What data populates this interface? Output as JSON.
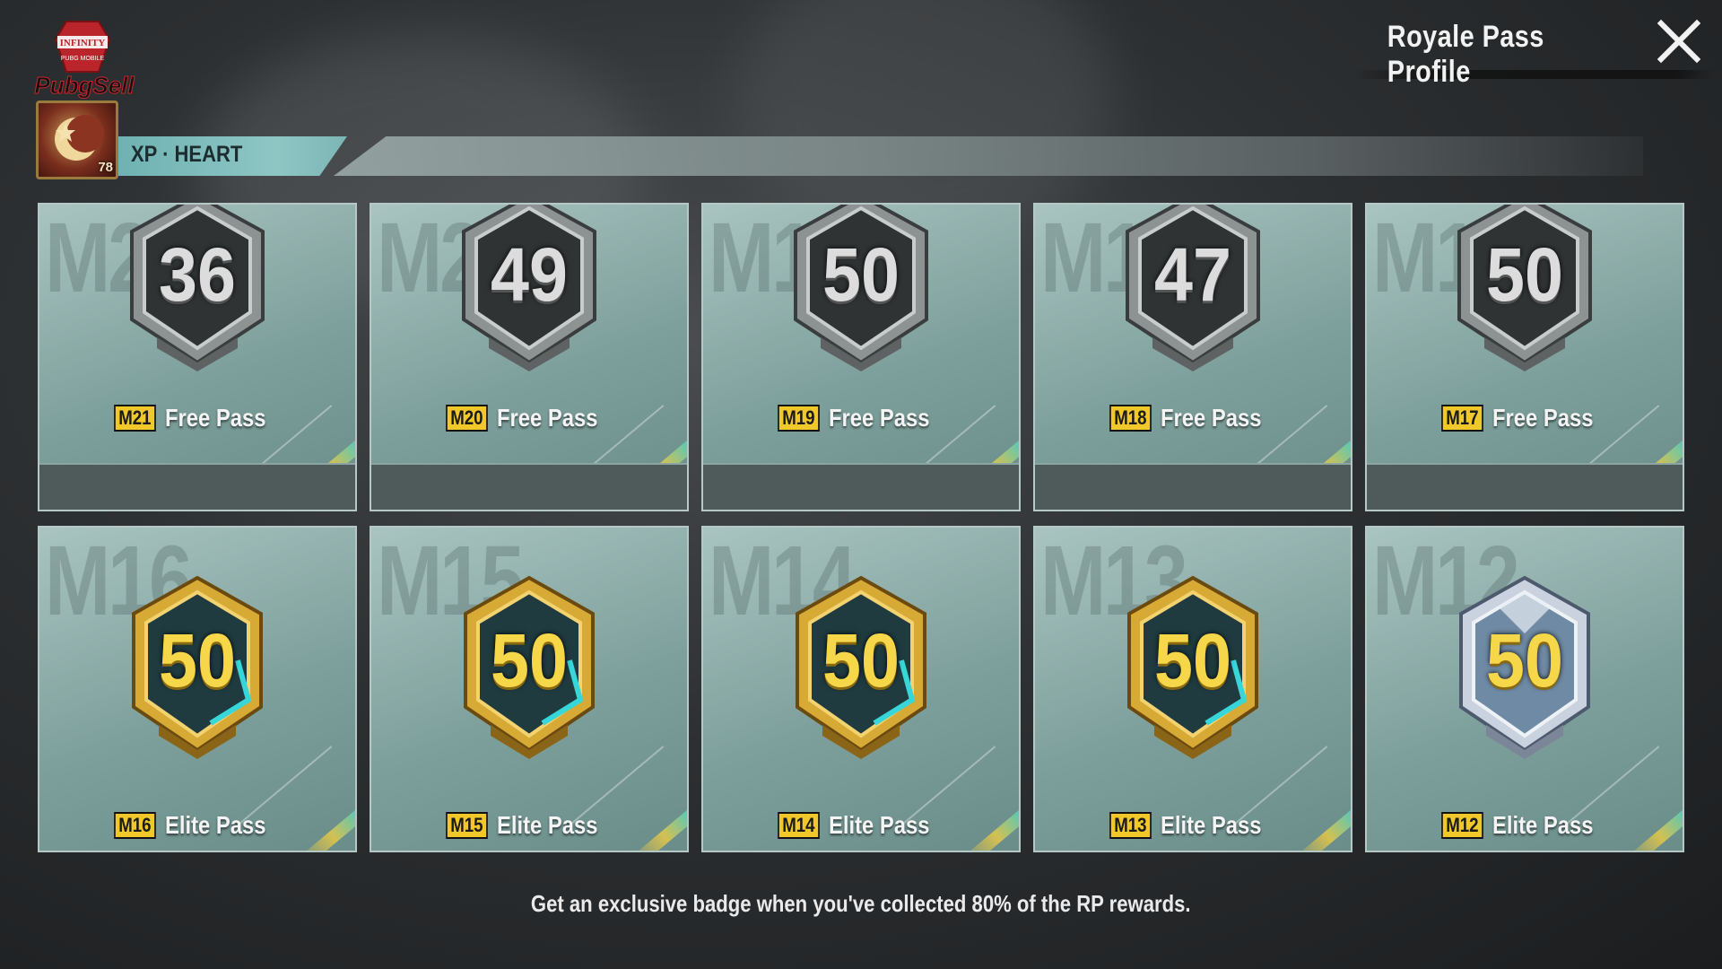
{
  "header": {
    "title": "Royale Pass Profile",
    "close_icon": "close-icon"
  },
  "logo": {
    "line1": "INFINITY",
    "line2": "PUBG MOBILE",
    "wordmark": "PubgSell"
  },
  "player": {
    "name": "XP · HEART",
    "level": "78",
    "avatar_icon": "crescent-moon-avatar"
  },
  "free_passes": [
    {
      "season": "M21",
      "pass": "Free Pass",
      "rank": "36",
      "watermark": "M21"
    },
    {
      "season": "M20",
      "pass": "Free Pass",
      "rank": "49",
      "watermark": "M20"
    },
    {
      "season": "M19",
      "pass": "Free Pass",
      "rank": "50",
      "watermark": "M19"
    },
    {
      "season": "M18",
      "pass": "Free Pass",
      "rank": "47",
      "watermark": "M18"
    },
    {
      "season": "M17",
      "pass": "Free Pass",
      "rank": "50",
      "watermark": "M17"
    }
  ],
  "elite_passes": [
    {
      "season": "M16",
      "pass": "Elite Pass",
      "rank": "50",
      "watermark": "M16"
    },
    {
      "season": "M15",
      "pass": "Elite Pass",
      "rank": "50",
      "watermark": "M15"
    },
    {
      "season": "M14",
      "pass": "Elite Pass",
      "rank": "50",
      "watermark": "M14"
    },
    {
      "season": "M13",
      "pass": "Elite Pass",
      "rank": "50",
      "watermark": "M13"
    },
    {
      "season": "M12",
      "pass": "Elite Pass",
      "rank": "50",
      "watermark": "M12"
    }
  ],
  "footnote": "Get an exclusive badge when you've collected 80% of the RP rewards.",
  "colors": {
    "card_teal": "#7ea09c",
    "season_tag": "#f1c829",
    "elite_number": "#f6d74a",
    "free_number": "#dcdcdc"
  }
}
